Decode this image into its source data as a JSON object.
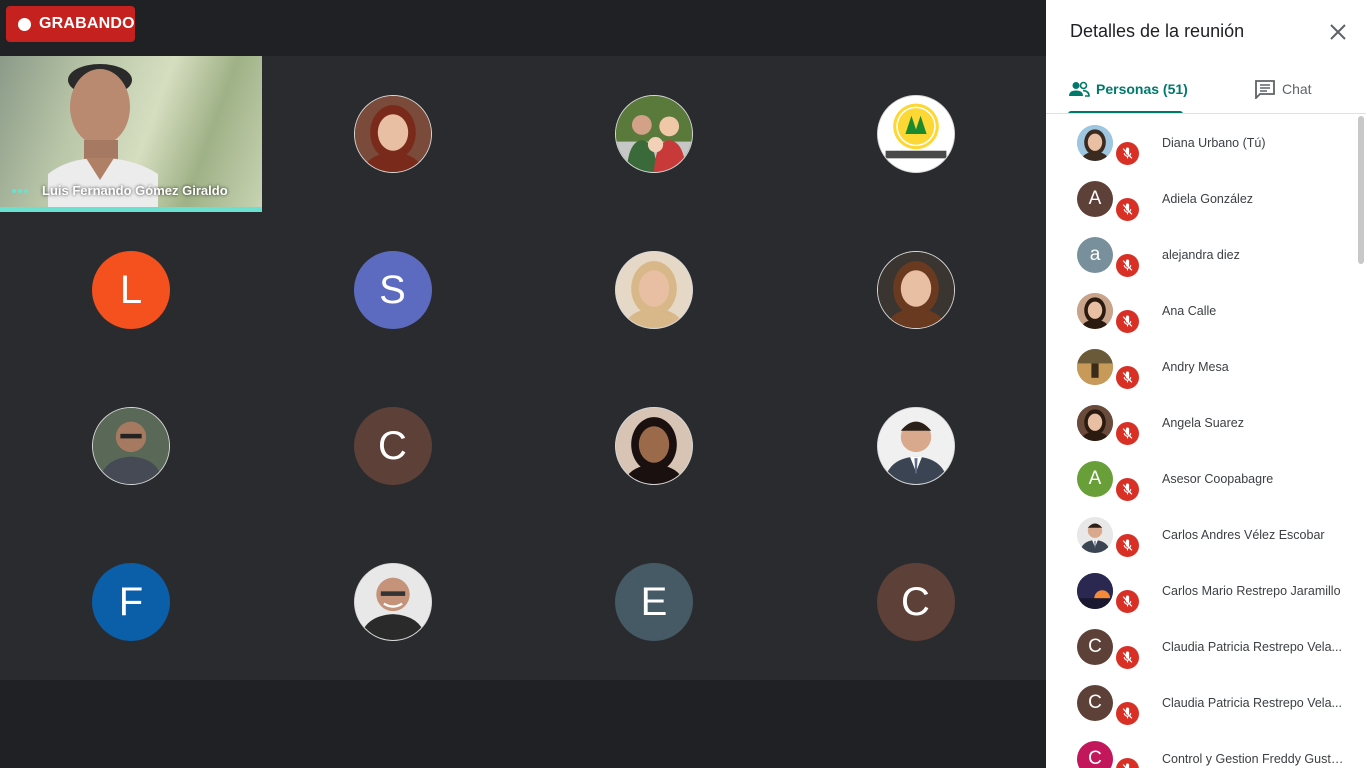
{
  "recording": {
    "label": "GRABANDO",
    "color": "#c5221f"
  },
  "speaker": {
    "name": "Luis Fernando Gómez Giraldo",
    "accent": "#6ae0d0"
  },
  "tiles": [
    {
      "type": "photo",
      "icon": "woman-red-hair-photo",
      "bg": "#7a4a3a"
    },
    {
      "type": "photo",
      "icon": "family-photo",
      "bg": "#5a7a3c"
    },
    {
      "type": "photo",
      "icon": "coopabagre-logo",
      "bg": "#f4f4f4"
    },
    {
      "type": "letter",
      "letter": "L",
      "bg": "#f4511e"
    },
    {
      "type": "letter",
      "letter": "S",
      "bg": "#5c6bc0"
    },
    {
      "type": "photo",
      "icon": "woman-blonde-photo",
      "bg": "#e6d8c6"
    },
    {
      "type": "photo",
      "icon": "woman-brown-hair-photo",
      "bg": "#3a3530"
    },
    {
      "type": "photo",
      "icon": "man-glasses-suit-photo",
      "bg": "#5a6858"
    },
    {
      "type": "letter",
      "letter": "C",
      "bg": "#5d4037"
    },
    {
      "type": "photo",
      "icon": "woman-smiling-photo",
      "bg": "#d7c4b4"
    },
    {
      "type": "photo",
      "icon": "man-suit-tie-photo",
      "bg": "#f0f0f0"
    },
    {
      "type": "letter",
      "letter": "F",
      "bg": "#0b5ea8"
    },
    {
      "type": "photo",
      "icon": "man-bald-glasses-photo",
      "bg": "#e8e8e8"
    },
    {
      "type": "letter",
      "letter": "E",
      "bg": "#455a64"
    },
    {
      "type": "letter",
      "letter": "C",
      "bg": "#5d4037"
    }
  ],
  "panel": {
    "title": "Detalles de la reunión",
    "tab_people": "Personas (51)",
    "tab_chat": "Chat",
    "accent": "#00796b"
  },
  "participants": [
    {
      "name": "Diana Urbano (Tú)",
      "avatar": "photo",
      "icon": "woman-sunglasses-photo",
      "bg": "#9ec6e0"
    },
    {
      "name": "Adiela González",
      "avatar": "letter",
      "letter": "A",
      "bg": "#5d4037"
    },
    {
      "name": "alejandra diez",
      "avatar": "letter",
      "letter": "a",
      "bg": "#78909c"
    },
    {
      "name": "Ana Calle",
      "avatar": "photo",
      "icon": "woman-dark-hair-photo",
      "bg": "#c9a48a"
    },
    {
      "name": "Andry Mesa",
      "avatar": "photo",
      "icon": "outdoor-scene-photo",
      "bg": "#a07a4a"
    },
    {
      "name": "Angela Suarez",
      "avatar": "photo",
      "icon": "couple-photo",
      "bg": "#6a4a3a"
    },
    {
      "name": "Asesor Coopabagre",
      "avatar": "letter",
      "letter": "A",
      "bg": "#689f38"
    },
    {
      "name": "Carlos Andres Vélez Escobar",
      "avatar": "photo",
      "icon": "man-suit-photo",
      "bg": "#e8e8e8"
    },
    {
      "name": "Carlos Mario Restrepo Jaramillo",
      "avatar": "photo",
      "icon": "sunset-photo",
      "bg": "#3a3050"
    },
    {
      "name": "Claudia Patricia Restrepo Vela...",
      "avatar": "letter",
      "letter": "C",
      "bg": "#5d4037"
    },
    {
      "name": "Claudia Patricia Restrepo Vela...",
      "avatar": "letter",
      "letter": "C",
      "bg": "#5d4037"
    },
    {
      "name": "Control y Gestion Freddy Gusta...",
      "avatar": "letter",
      "letter": "C",
      "bg": "#c2185b"
    }
  ]
}
